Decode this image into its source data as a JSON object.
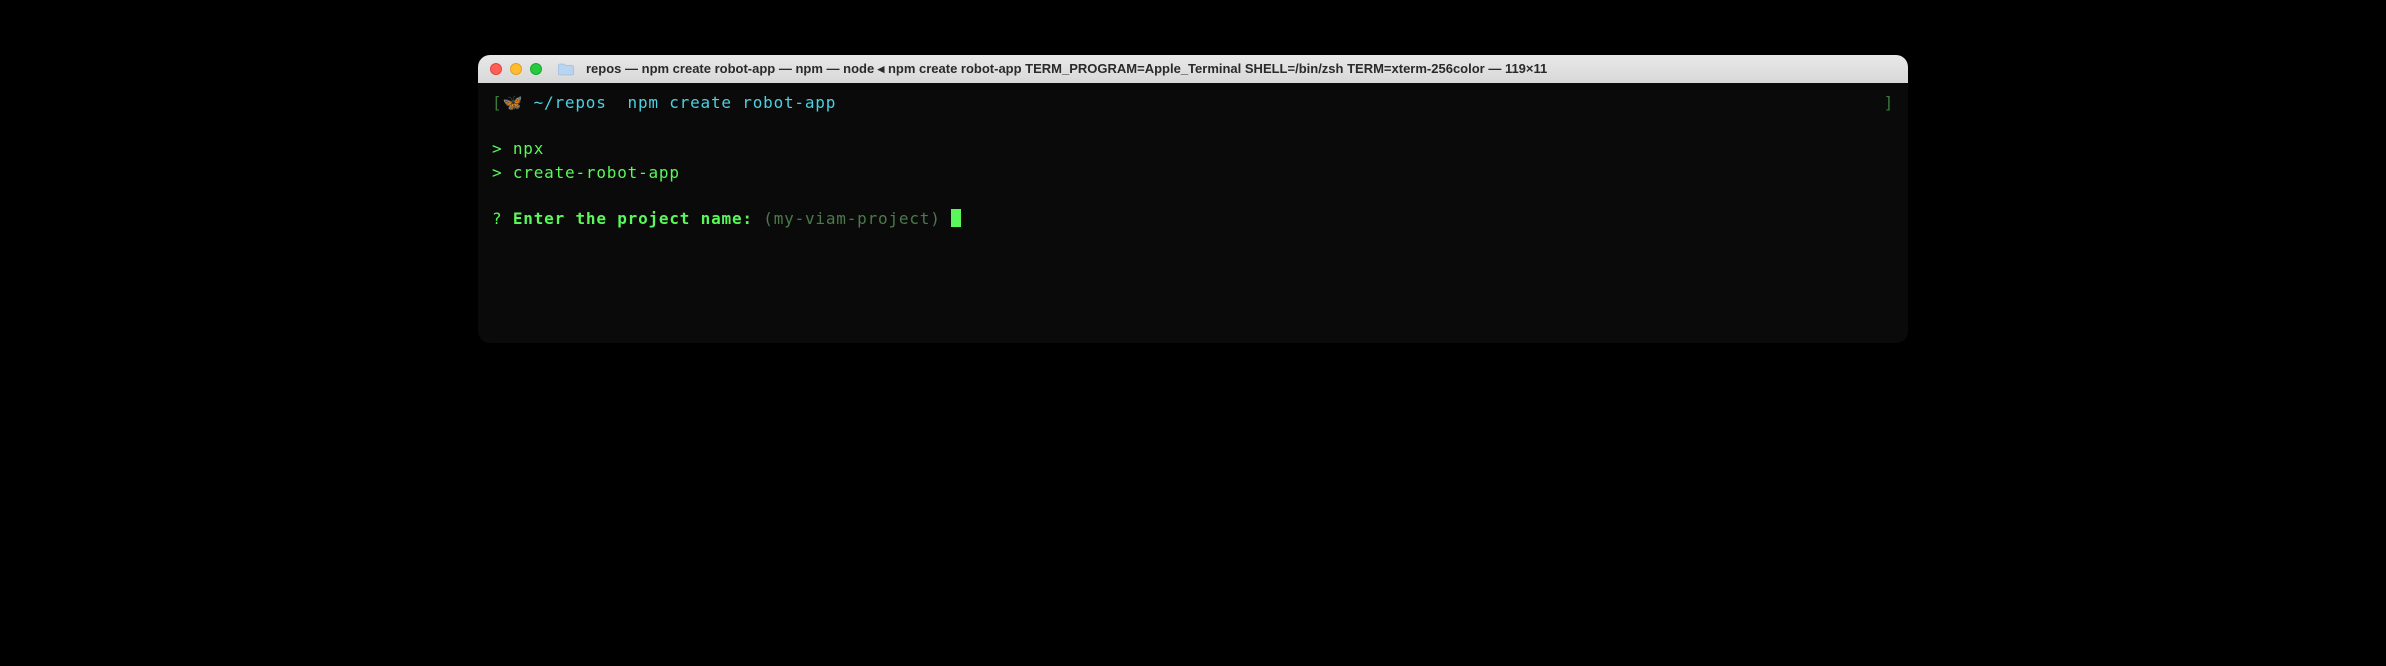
{
  "window": {
    "title": "repos — npm create robot-app — npm — node ◂ npm create robot-app TERM_PROGRAM=Apple_Terminal SHELL=/bin/zsh TERM=xterm-256color — 119×11"
  },
  "terminal": {
    "prompt_left_bracket": "[",
    "prompt_icon": "🦋",
    "prompt_path": " ~/repos ",
    "prompt_command": " npm create robot-app",
    "prompt_right_bracket": "]",
    "line_npx_prefix": "> ",
    "line_npx": "npx",
    "line_create_prefix": "> ",
    "line_create": "create-robot-app",
    "question_mark": "?",
    "question_text": " Enter the project name: ",
    "question_default": "(my-viam-project) "
  }
}
